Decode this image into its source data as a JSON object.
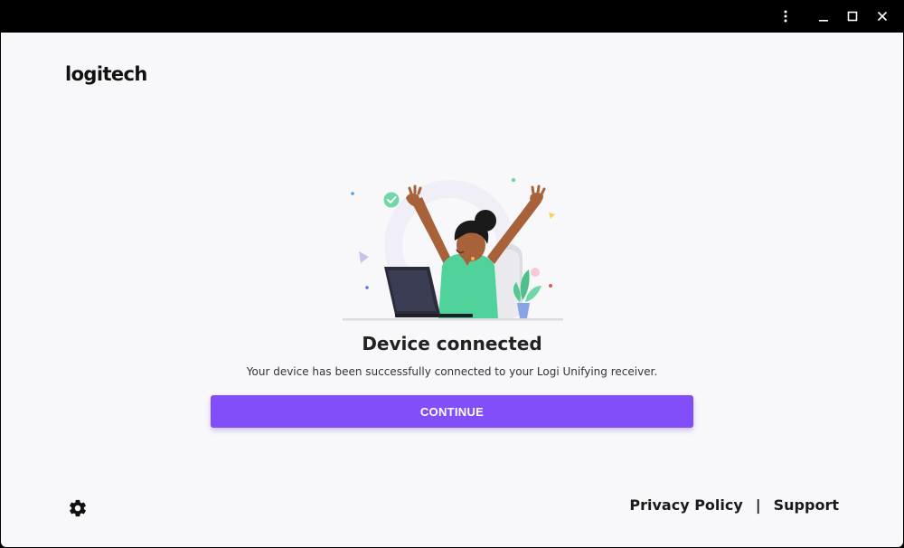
{
  "window": {
    "controls": {
      "more_icon": "more-vertical-icon",
      "minimize_icon": "minimize-icon",
      "maximize_icon": "maximize-icon",
      "close_icon": "close-icon"
    }
  },
  "brand": {
    "logo_text": "logitech"
  },
  "main": {
    "title": "Device connected",
    "message": "Your device has been successfully connected to your Logi Unifying receiver.",
    "continue_label": "CONTINUE"
  },
  "footer": {
    "privacy_label": "Privacy Policy",
    "separator": "|",
    "support_label": "Support",
    "settings_icon": "gear-icon"
  },
  "colors": {
    "accent": "#814efa",
    "background": "#f8f8fa",
    "titlebar": "#000000",
    "shirt": "#4fd39a",
    "skin": "#a8623a"
  }
}
